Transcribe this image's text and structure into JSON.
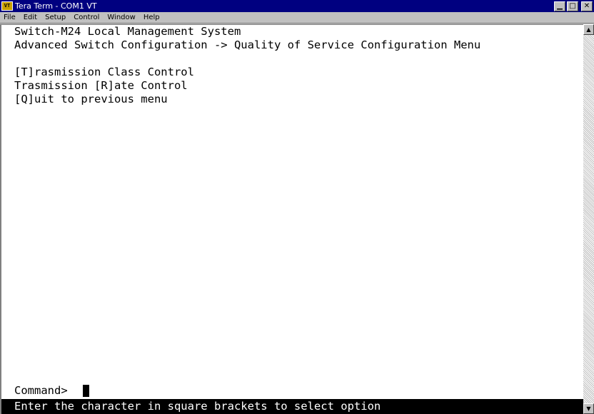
{
  "window": {
    "title": "Tera Term - COM1 VT",
    "icon": "VT"
  },
  "menu": [
    "File",
    "Edit",
    "Setup",
    "Control",
    "Window",
    "Help"
  ],
  "terminal": {
    "lines": [
      "Switch-M24 Local Management System",
      "Advanced Switch Configuration -> Quality of Service Configuration Menu",
      "",
      "[T]rasmission Class Control",
      "Trasmission [R]ate Control",
      "[Q]uit to previous menu"
    ],
    "prompt": "Command>",
    "status": "Enter the character in square brackets to select option"
  },
  "window_buttons": {
    "minimize": "▁",
    "maximize": "□",
    "close": "✕"
  }
}
